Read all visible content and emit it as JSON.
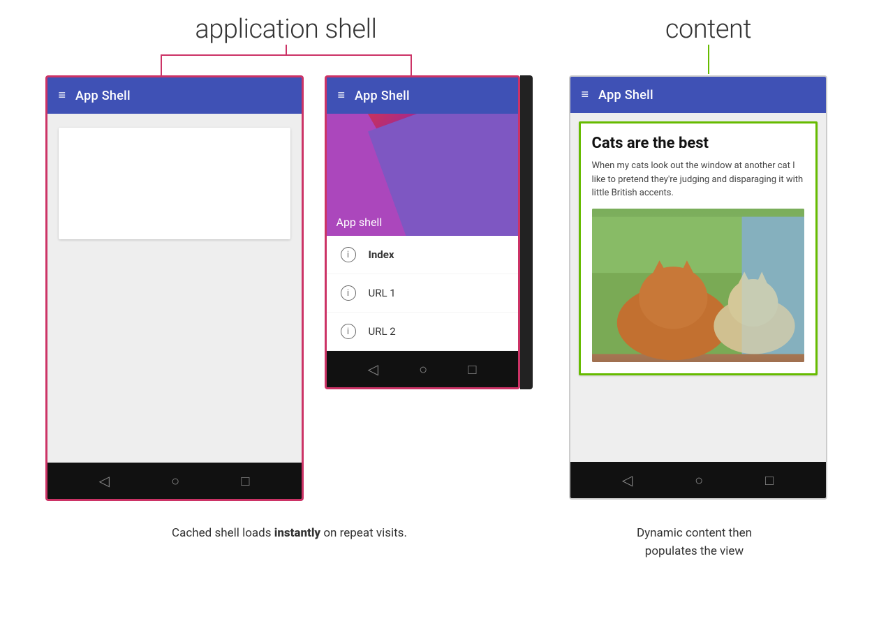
{
  "labels": {
    "app_shell_heading": "application shell",
    "content_heading": "content"
  },
  "phone1": {
    "app_bar_title": "App Shell",
    "hamburger": "≡"
  },
  "phone2": {
    "app_bar_title": "App Shell",
    "hamburger": "≡",
    "hero_label": "App shell",
    "nav_items": [
      {
        "label": "Index",
        "bold": true
      },
      {
        "label": "URL 1",
        "bold": false
      },
      {
        "label": "URL 2",
        "bold": false
      }
    ]
  },
  "phone3": {
    "app_bar_title": "App Shell",
    "hamburger": "≡",
    "content_title": "Cats are the best",
    "content_body": "When my cats look out the window at another cat I like to pretend they're judging and disparaging it with little British accents."
  },
  "nav_icons": {
    "back": "◁",
    "home": "○",
    "recent": "□"
  },
  "captions": {
    "left": "Cached shell loads ",
    "left_bold": "instantly",
    "left_suffix": " on repeat visits.",
    "right_line1": "Dynamic content then",
    "right_line2": "populates the view"
  }
}
